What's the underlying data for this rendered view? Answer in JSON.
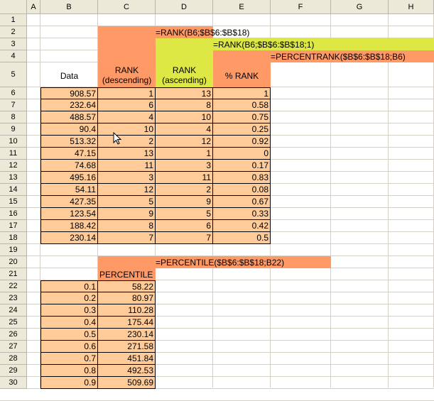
{
  "columns": [
    "A",
    "B",
    "C",
    "D",
    "E",
    "F",
    "G",
    "H"
  ],
  "rows": [
    "1",
    "2",
    "3",
    "4",
    "5",
    "6",
    "7",
    "8",
    "9",
    "10",
    "11",
    "12",
    "13",
    "14",
    "15",
    "16",
    "17",
    "18",
    "19",
    "20",
    "21",
    "22",
    "23",
    "24",
    "25",
    "26",
    "27",
    "28",
    "29",
    "30"
  ],
  "formulas": {
    "rank_desc": "=RANK(B6;$B$6:$B$18)",
    "rank_asc": "=RANK(B6;$B$6:$B$18;1)",
    "percentrank": "=PERCENTRANK($B$6:$B$18;B6)",
    "percentile": "=PERCENTILE($B$6:$B$18;B22)"
  },
  "headers": {
    "data": "Data",
    "rank_desc_1": "RANK",
    "rank_desc_2": "(descending)",
    "rank_asc_1": "RANK",
    "rank_asc_2": "(ascending)",
    "pct_rank": "% RANK",
    "percentile": "PERCENTILE"
  },
  "table1": [
    {
      "data": "908.57",
      "desc": "1",
      "asc": "13",
      "pct": "1"
    },
    {
      "data": "232.64",
      "desc": "6",
      "asc": "8",
      "pct": "0.58"
    },
    {
      "data": "488.57",
      "desc": "4",
      "asc": "10",
      "pct": "0.75"
    },
    {
      "data": "90.4",
      "desc": "10",
      "asc": "4",
      "pct": "0.25"
    },
    {
      "data": "513.32",
      "desc": "2",
      "asc": "12",
      "pct": "0.92"
    },
    {
      "data": "47.15",
      "desc": "13",
      "asc": "1",
      "pct": "0"
    },
    {
      "data": "74.68",
      "desc": "11",
      "asc": "3",
      "pct": "0.17"
    },
    {
      "data": "495.16",
      "desc": "3",
      "asc": "11",
      "pct": "0.83"
    },
    {
      "data": "54.11",
      "desc": "12",
      "asc": "2",
      "pct": "0.08"
    },
    {
      "data": "427.35",
      "desc": "5",
      "asc": "9",
      "pct": "0.67"
    },
    {
      "data": "123.54",
      "desc": "9",
      "asc": "5",
      "pct": "0.33"
    },
    {
      "data": "188.42",
      "desc": "8",
      "asc": "6",
      "pct": "0.42"
    },
    {
      "data": "230.14",
      "desc": "7",
      "asc": "7",
      "pct": "0.5"
    }
  ],
  "table2": [
    {
      "k": "0.1",
      "v": "58.22"
    },
    {
      "k": "0.2",
      "v": "80.97"
    },
    {
      "k": "0.3",
      "v": "110.28"
    },
    {
      "k": "0.4",
      "v": "175.44"
    },
    {
      "k": "0.5",
      "v": "230.14"
    },
    {
      "k": "0.6",
      "v": "271.58"
    },
    {
      "k": "0.7",
      "v": "451.84"
    },
    {
      "k": "0.8",
      "v": "492.53"
    },
    {
      "k": "0.9",
      "v": "509.69"
    }
  ],
  "colors": {
    "peach": "#ffcc99",
    "salmon": "#ff9966",
    "lime": "#dde844",
    "header_bg": "#ece9d8"
  },
  "cursor_icon": "mouse-pointer-icon"
}
